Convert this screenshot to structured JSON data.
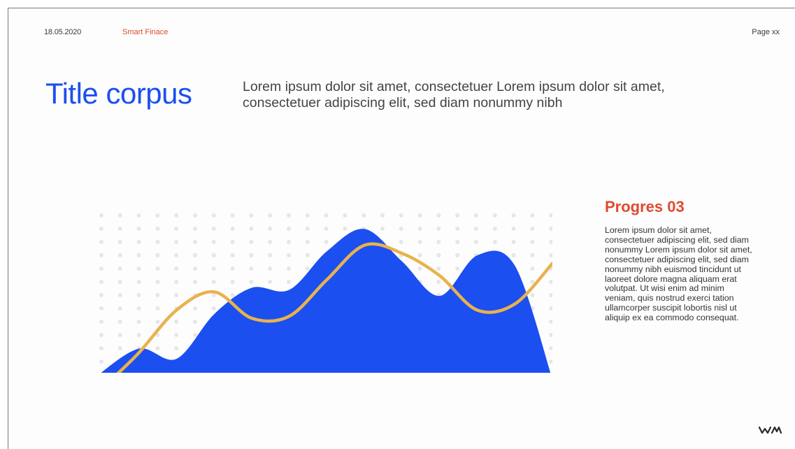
{
  "header": {
    "date": "18.05.2020",
    "brand": "Smart Finace",
    "page_label": "Page xx"
  },
  "hero": {
    "title": "Title corpus",
    "lead": "Lorem ipsum dolor sit amet, consectetuer Lorem ipsum dolor sit amet, consectetuer adipiscing elit, sed diam nonummy nibh"
  },
  "side": {
    "heading": "Progres 03",
    "body": "Lorem ipsum dolor sit amet, consectetuer adipiscing elit, sed diam nonummy Lorem ipsum dolor sit amet, consectetuer adipiscing elit, sed diam nonummy nibh euismod tincidunt ut laoreet dolore magna aliquam erat volutpat. Ut wisi enim ad minim veniam, quis nostrud exerci tation ullamcorper suscipit lobortis nisl ut aliquip ex ea commodo consequat."
  },
  "logo": {
    "icon": "wm-logo-icon",
    "text": "WM"
  },
  "colors": {
    "accent_blue": "#1c4ff0",
    "accent_red": "#e04a2f",
    "line_yellow": "#e8b24e",
    "dot_gray": "#e6e6e6"
  },
  "chart_data": {
    "type": "area",
    "grid": "dot-matrix",
    "series": [
      {
        "values": [
          0.1,
          0.75,
          0.5,
          1.6,
          2.25,
          2.2,
          3.15,
          3.7,
          2.9,
          2.05,
          3.05,
          2.8,
          0.0
        ]
      },
      {
        "values": [
          0.0,
          0.65,
          1.7,
          2.15,
          1.5,
          1.55,
          2.45,
          3.3,
          3.1,
          2.55,
          1.7,
          1.85,
          2.85
        ]
      }
    ]
  }
}
